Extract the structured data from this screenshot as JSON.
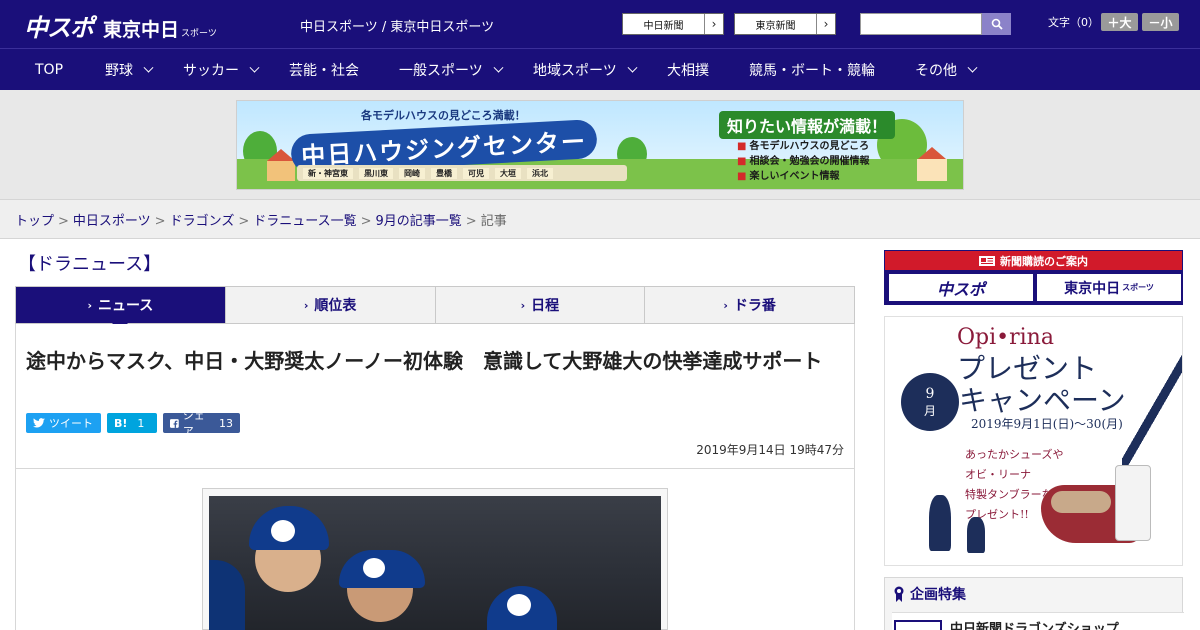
{
  "header": {
    "logo_main": "中スポ",
    "logo_sub": "東京中日",
    "logo_sub_small": "スポーツ",
    "site_links": "中日スポーツ / 東京中日スポーツ",
    "paper_buttons": [
      {
        "label": "中日新聞"
      },
      {
        "label": "東京新聞"
      }
    ],
    "search_placeholder": "",
    "fontsize_label": "文字（0）",
    "fontsize_up": "＋大",
    "fontsize_down": "－小"
  },
  "nav": {
    "items": [
      {
        "label": "TOP",
        "dropdown": false
      },
      {
        "label": "野球",
        "dropdown": true
      },
      {
        "label": "サッカー",
        "dropdown": true
      },
      {
        "label": "芸能・社会",
        "dropdown": false
      },
      {
        "label": "一般スポーツ",
        "dropdown": true
      },
      {
        "label": "地域スポーツ",
        "dropdown": true
      },
      {
        "label": "大相撲",
        "dropdown": false
      },
      {
        "label": "競馬・ボート・競輪",
        "dropdown": false
      },
      {
        "label": "その他",
        "dropdown": true
      }
    ]
  },
  "ad_banner": {
    "headline_small": "各モデルハウスの見どころ満載！",
    "headline_main": "中日ハウジングセンター",
    "tagline": "知りたい情報が満載！",
    "bullets": [
      "各モデルハウスの見どころ",
      "相談会・勉強会の開催情報",
      "楽しいイベント情報"
    ],
    "locations": [
      "新・神宮東",
      "黒川東",
      "岡崎",
      "豊橋",
      "可児",
      "大垣",
      "浜北"
    ]
  },
  "breadcrumb": {
    "items": [
      "トップ",
      "中日スポーツ",
      "ドラゴンズ",
      "ドラニュース一覧",
      "9月の記事一覧"
    ],
    "current": "記事",
    "separator": ">"
  },
  "section": {
    "title": "【ドラニュース】"
  },
  "tabs": [
    {
      "label": "ニュース",
      "active": true
    },
    {
      "label": "順位表",
      "active": false
    },
    {
      "label": "日程",
      "active": false
    },
    {
      "label": "ドラ番",
      "active": false
    }
  ],
  "article": {
    "headline": "途中からマスク、中日・大野奨太ノーノー初体験　意識して大野雄大の快挙達成サポート",
    "share": {
      "tweet_label": "ツイート",
      "hatena_label": "B!",
      "hatena_count": "1",
      "facebook_label": "シェア",
      "facebook_count": "13"
    },
    "datetime": "2019年9月14日 19時47分"
  },
  "sidebar": {
    "subscription": {
      "header": "新聞購読のご案内",
      "buttons": [
        "中スポ",
        "東京中日"
      ],
      "button2_small": "スポーツ"
    },
    "promo": {
      "brand": "Opi•rina",
      "title_line1": "プレゼント",
      "title_line2": "キャンペーン",
      "dates": "2019年9月1日(日)〜30(月)",
      "month_num": "9",
      "month_unit": "月",
      "note_lines": [
        "あったかシューズや",
        "オビ・リーナ",
        "特製タンブラーなど",
        "プレゼント!!"
      ]
    },
    "features": {
      "title": "企画特集",
      "first_item": "中日新聞ドラゴンズショップ"
    }
  },
  "colors": {
    "brand_navy": "#1a0f7a",
    "accent_red": "#d11a2a",
    "twitter": "#1da1f2",
    "hatena": "#00a4de",
    "facebook": "#3b5998"
  }
}
